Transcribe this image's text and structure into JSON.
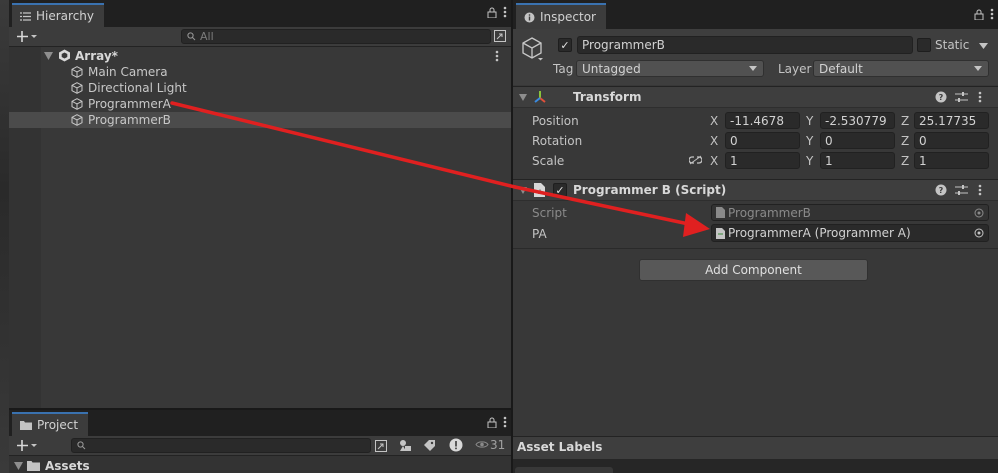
{
  "hierarchy": {
    "tab_label": "Hierarchy",
    "search_placeholder": "All",
    "scene_name": "Array*",
    "items": [
      {
        "label": "Main Camera"
      },
      {
        "label": "Directional Light"
      },
      {
        "label": "ProgrammerA"
      },
      {
        "label": "ProgrammerB"
      }
    ]
  },
  "project": {
    "tab_label": "Project",
    "hidden_count": "31",
    "folder": "Assets"
  },
  "inspector": {
    "tab_label": "Inspector",
    "object_name": "ProgrammerB",
    "static_label": "Static",
    "tag_label": "Tag",
    "tag_value": "Untagged",
    "layer_label": "Layer",
    "layer_value": "Default",
    "transform": {
      "title": "Transform",
      "position_label": "Position",
      "rotation_label": "Rotation",
      "scale_label": "Scale",
      "x_label": "X",
      "y_label": "Y",
      "z_label": "Z",
      "position": {
        "x": "-11.4678",
        "y": "-2.530779",
        "z": "25.17735"
      },
      "rotation": {
        "x": "0",
        "y": "0",
        "z": "0"
      },
      "scale": {
        "x": "1",
        "y": "1",
        "z": "1"
      }
    },
    "script_component": {
      "title": "Programmer B (Script)",
      "script_label": "Script",
      "script_value": "ProgrammerB",
      "pa_label": "PA",
      "pa_value": "ProgrammerA (Programmer A)"
    },
    "add_component_label": "Add Component",
    "asset_labels": "Asset Labels"
  },
  "colors": {
    "annotation_arrow": "#e02020",
    "tab_accent": "#3a72b0",
    "selection": "#4b4b4b"
  }
}
